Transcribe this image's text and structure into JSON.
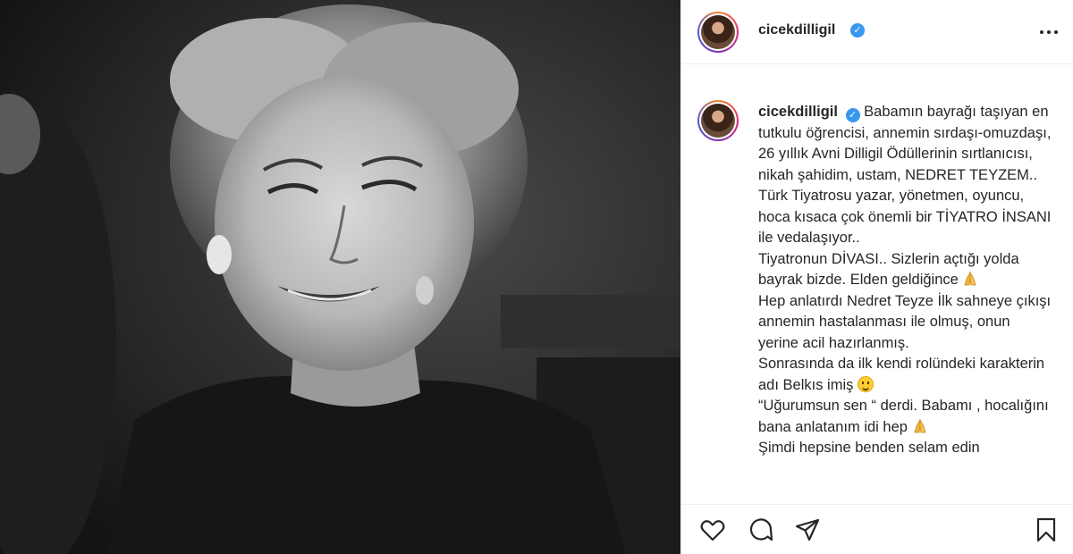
{
  "post": {
    "username": "cicekdilligil",
    "verified": true,
    "photo_icon": "portrait-photo",
    "more_icon": "more-options-icon"
  },
  "caption": {
    "username": "cicekdilligil",
    "paragraphs": [
      "Babamın bayrağı taşıyan en tutkulu öğrencisi, annemin sırdaşı-omuzdaşı, 26 yıllık Avni Dilligil Ödüllerinin sırtlanıcısı, nikah şahidim, ustam, NEDRET TEYZEM..",
      "Türk Tiyatrosu yazar, yönetmen, oyuncu, hoca kısaca çok önemli bir TİYATRO İNSANI ile vedalaşıyor..",
      "Tiyatronun DİVASI.. Sizlerin açtığı yolda bayrak bizde. Elden geldiğince",
      "Hep anlatırdı Nedret Teyze İlk sahneye çıkışı annemin hastalanması ile olmuş, onun yerine acil hazırlanmış.",
      "Sonrasında da ilk kendi rolündeki karakterin adı Belkıs imiş",
      "“Uğurumsun sen “ derdi. Babamı , hocalığını bana anlatanım idi hep",
      "Şimdi hepsine benden selam edin"
    ]
  },
  "actions": {
    "like": "heart-icon",
    "comment": "comment-icon",
    "share": "send-icon",
    "save": "bookmark-icon"
  },
  "colors": {
    "verified_badge": "#3897f0",
    "text": "#262626",
    "divider": "#efefef"
  }
}
